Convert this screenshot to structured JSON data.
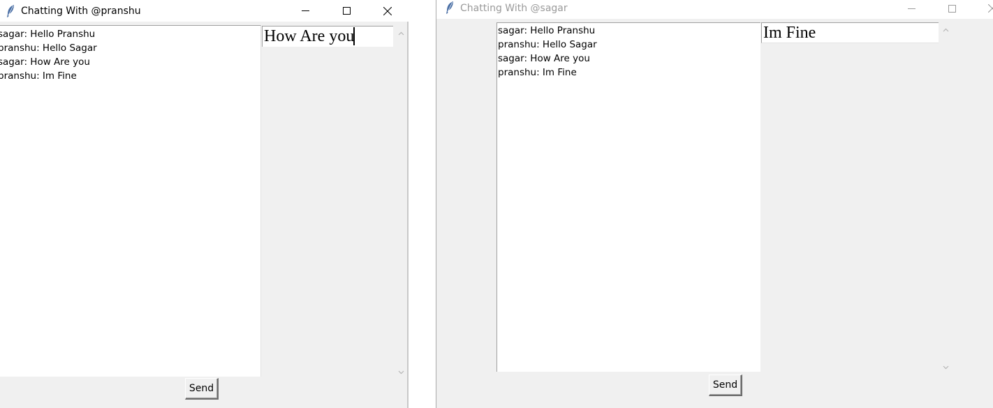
{
  "windows": [
    {
      "title": "Chatting With @pranshu",
      "active": true,
      "chat_log": [
        "sagar: Hello Pranshu",
        "pranshu: Hello Sagar",
        "sagar: How Are you",
        "pranshu: Im Fine"
      ],
      "entry_value": "How Are you",
      "send_label": "Send"
    },
    {
      "title": "Chatting With @sagar",
      "active": false,
      "chat_log": [
        "sagar: Hello Pranshu",
        "pranshu: Hello Sagar",
        "sagar: How Are you",
        "pranshu: Im Fine"
      ],
      "entry_value": "Im Fine",
      "send_label": "Send"
    }
  ],
  "icons": {
    "app": "feather-icon",
    "minimize": "minimize-icon",
    "maximize": "maximize-icon",
    "close": "close-icon",
    "scroll_up": "chevron-up-icon",
    "scroll_down": "chevron-down-icon"
  },
  "colors": {
    "window_bg": "#f0f0f0",
    "titlebar_bg": "#ffffff",
    "text_area_bg": "#ffffff",
    "inactive_title": "#9a9a9a"
  }
}
